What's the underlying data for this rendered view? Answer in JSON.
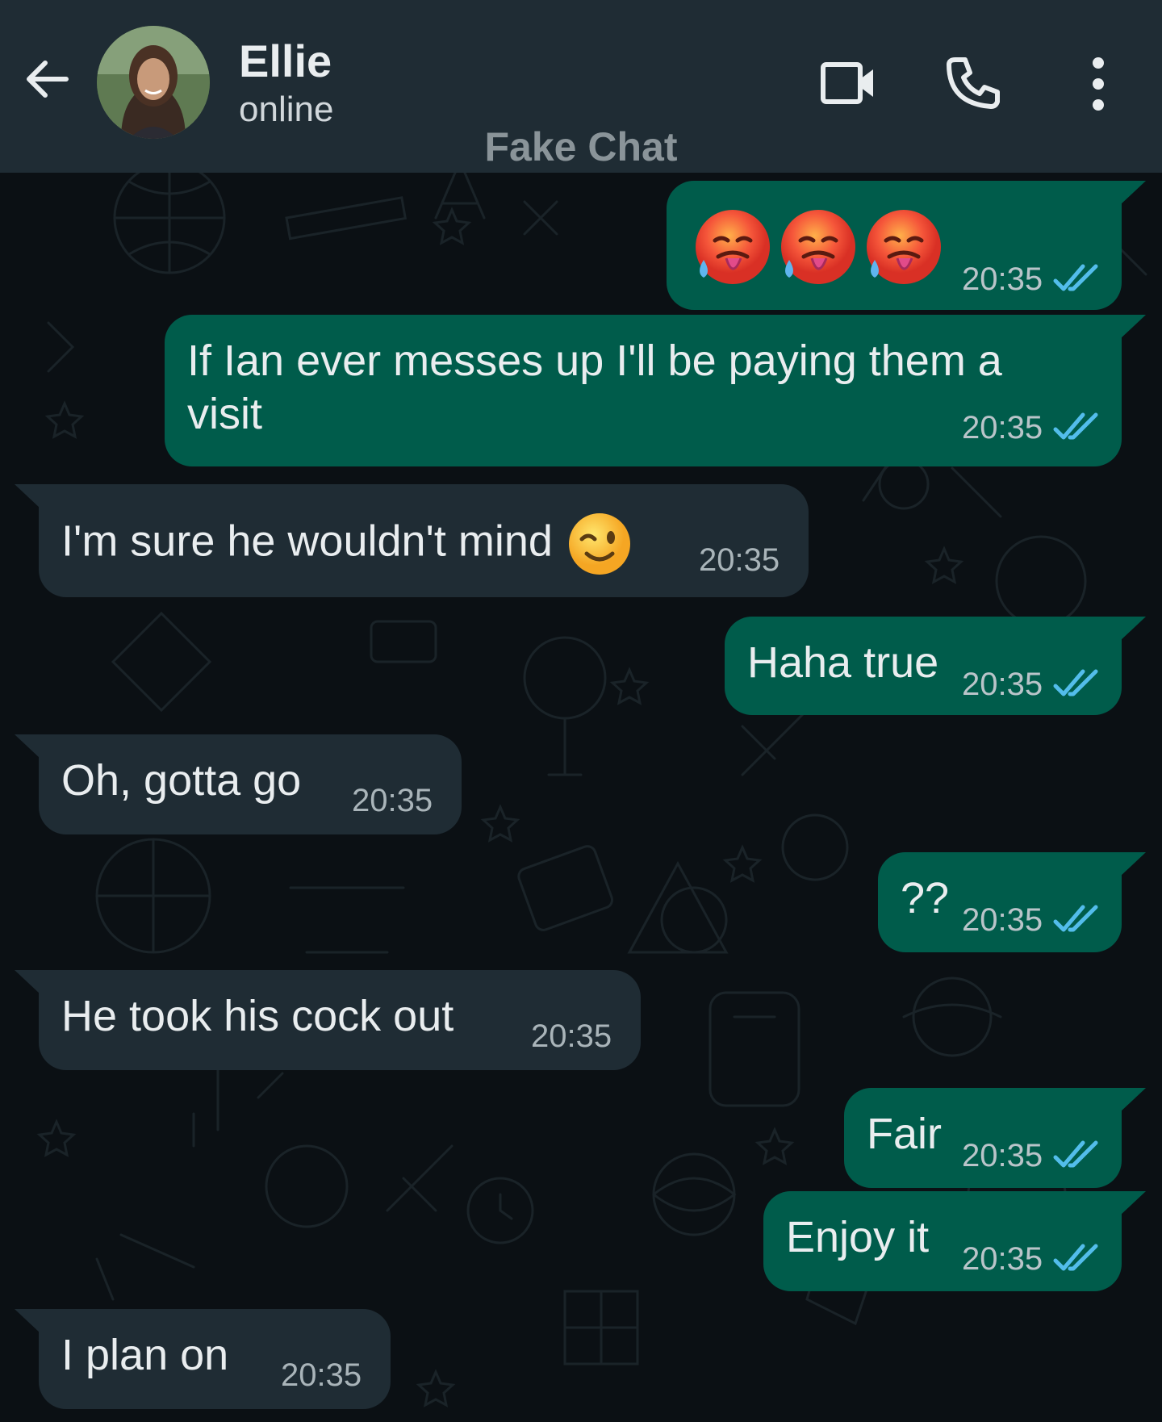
{
  "header": {
    "contact_name": "Ellie",
    "status": "online",
    "watermark": "Fake Chat",
    "icons": [
      "back-arrow-icon",
      "video-call-icon",
      "phone-icon",
      "more-options-icon"
    ]
  },
  "colors": {
    "header_bg": "#1f2c34",
    "chat_bg": "#0b1014",
    "outgoing_bubble": "#005c4b",
    "incoming_bubble": "#1f2c34",
    "read_ticks": "#53bdeb"
  },
  "messages": [
    {
      "direction": "out",
      "text": "",
      "emoji": [
        "hot-face-with-sweat",
        "hot-face-with-sweat",
        "hot-face-with-sweat"
      ],
      "time": "20:35",
      "read": true
    },
    {
      "direction": "out",
      "text": "If Ian ever messes up I'll be paying them a\nvisit",
      "time": "20:35",
      "read": true
    },
    {
      "direction": "in",
      "text": "I'm sure he wouldn't mind",
      "emoji": [
        "winking-face"
      ],
      "time": "20:35"
    },
    {
      "direction": "out",
      "text": "Haha true",
      "time": "20:35",
      "read": true
    },
    {
      "direction": "in",
      "text": "Oh, gotta go",
      "time": "20:35"
    },
    {
      "direction": "out",
      "text": "??",
      "time": "20:35",
      "read": true
    },
    {
      "direction": "in",
      "text": "He took his cock out",
      "time": "20:35"
    },
    {
      "direction": "out",
      "text": "Fair",
      "time": "20:35",
      "read": true
    },
    {
      "direction": "out",
      "text": "Enjoy it",
      "time": "20:35",
      "read": true
    },
    {
      "direction": "in",
      "text": "I plan on",
      "time": "20:35"
    }
  ]
}
